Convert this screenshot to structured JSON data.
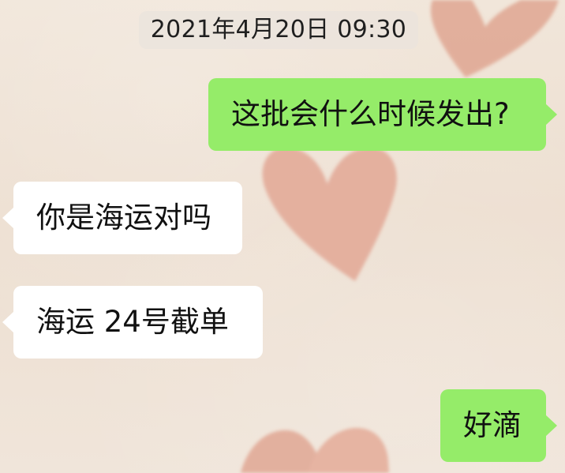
{
  "chat": {
    "timestamp": "2021年4月20日 09:30",
    "messages": [
      {
        "direction": "outgoing",
        "text": "这批会什么时候发出?"
      },
      {
        "direction": "incoming",
        "text": "你是海运对吗"
      },
      {
        "direction": "incoming",
        "text": "海运 24号截单"
      },
      {
        "direction": "outgoing",
        "text": "好滴"
      }
    ]
  },
  "theme": {
    "incoming_bubble": "#ffffff",
    "outgoing_bubble": "#95ec69",
    "wallpaper_base": "#efe3d6",
    "wallpaper_heart": "#e2a48f"
  }
}
